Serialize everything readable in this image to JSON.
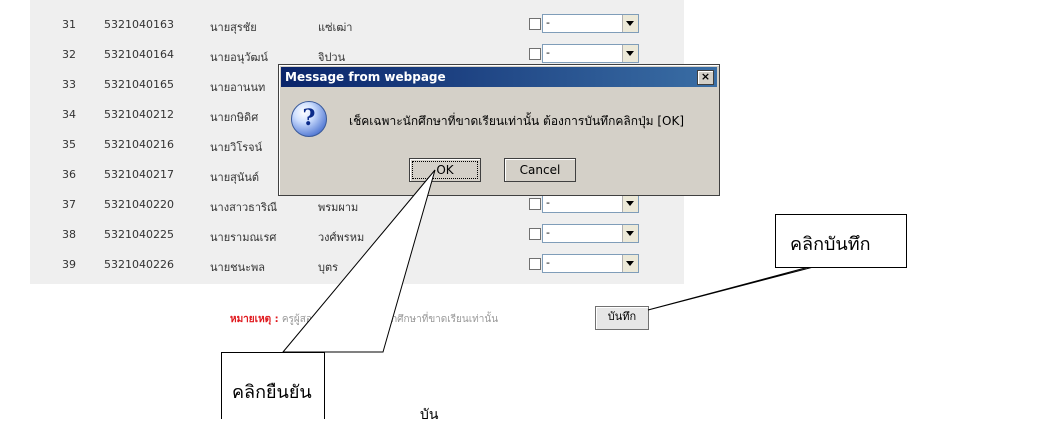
{
  "table": {
    "rows": [
      {
        "no": "31",
        "id": "5321040163",
        "name": "นายสุรชัย",
        "surname": "แซ่เฒ่า",
        "status": "-"
      },
      {
        "no": "32",
        "id": "5321040164",
        "name": "นายอนุวัฒน์",
        "surname": "จิปวน",
        "status": "-"
      },
      {
        "no": "33",
        "id": "5321040165",
        "name": "นายอานนท",
        "surname": "",
        "status": "-"
      },
      {
        "no": "34",
        "id": "5321040212",
        "name": "นายกษิดิศ",
        "surname": "",
        "status": "-"
      },
      {
        "no": "35",
        "id": "5321040216",
        "name": "นายวิโรจน์",
        "surname": "",
        "status": "-"
      },
      {
        "no": "36",
        "id": "5321040217",
        "name": "นายสุนันต์",
        "surname": "",
        "status": "-"
      },
      {
        "no": "37",
        "id": "5321040220",
        "name": "นางสาวธาริณี",
        "surname": "พรมผาม",
        "status": "-"
      },
      {
        "no": "38",
        "id": "5321040225",
        "name": "นายรามณเรศ",
        "surname": "วงศ์พรหม",
        "status": "-"
      },
      {
        "no": "39",
        "id": "5321040226",
        "name": "นายชนะพล",
        "surname": "บุตร",
        "status": "-"
      }
    ]
  },
  "note": {
    "label": "หมายเหตุ :",
    "text": "ครูผู้สอน เลือก นักเรียน นักศึกษาที่ขาดเรียนเท่านั้น"
  },
  "save_button": "บันทึก",
  "dialog": {
    "title": "Message from webpage",
    "close": "×",
    "icon": "?",
    "message": "เช็คเฉพาะนักศึกษาที่ขาดเรียนเท่านั้น ต้องการบันทึกคลิกปุ่ม [OK]",
    "ok": "OK",
    "cancel": "Cancel"
  },
  "callouts": {
    "save": "คลิกบันทึก",
    "confirm": "คลิกยืนยัน",
    "partial": "บัน"
  }
}
